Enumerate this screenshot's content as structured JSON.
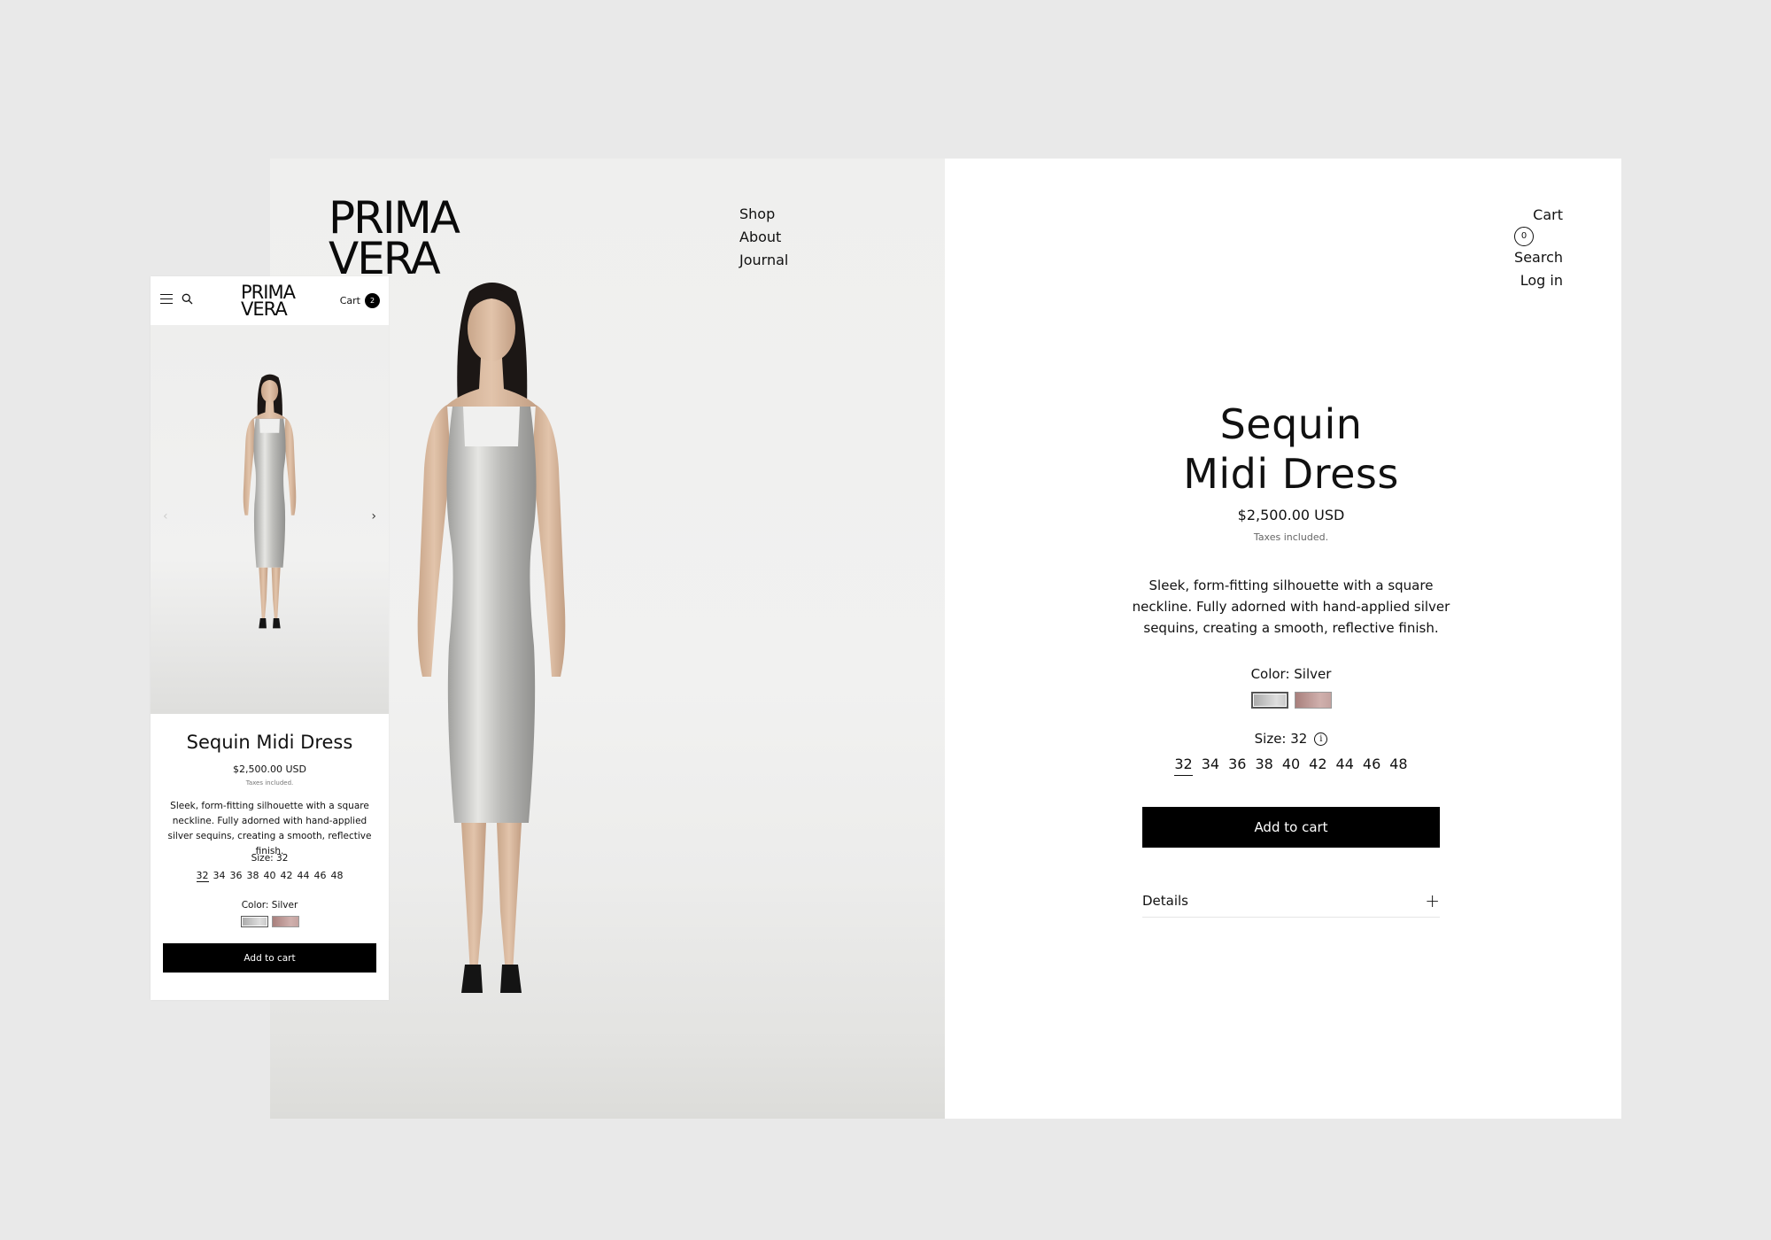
{
  "brand": {
    "line1": "PRIMA",
    "line2": "VERA"
  },
  "desktop": {
    "nav_left": [
      {
        "label": "Shop"
      },
      {
        "label": "About"
      },
      {
        "label": "Journal"
      }
    ],
    "nav_right": {
      "cart_label": "Cart",
      "cart_count": "0",
      "search_label": "Search",
      "login_label": "Log in"
    }
  },
  "product": {
    "title_line1": "Sequin",
    "title_line2": "Midi Dress",
    "title": "Sequin Midi Dress",
    "price": "$2,500.00 USD",
    "tax_note": "Taxes included.",
    "description": "Sleek, form-fitting silhouette with a square neckline. Fully adorned with hand-applied silver sequins, creating a smooth, reflective finish.",
    "color_label": "Color: Silver",
    "colors": [
      {
        "name": "Silver",
        "hex": "#c8c8c8",
        "selected": true
      },
      {
        "name": "Rose",
        "hex": "#b8918e",
        "selected": false
      }
    ],
    "size_label": "Size: 32",
    "sizes": [
      "32",
      "34",
      "36",
      "38",
      "40",
      "42",
      "44",
      "46",
      "48"
    ],
    "selected_size": "32",
    "add_to_cart_label": "Add to cart",
    "details_label": "Details"
  },
  "mobile": {
    "cart_label": "Cart",
    "cart_count": "2",
    "prev_arrow": "‹",
    "next_arrow": "›"
  },
  "icons": {
    "info": "i",
    "plus": "+"
  }
}
